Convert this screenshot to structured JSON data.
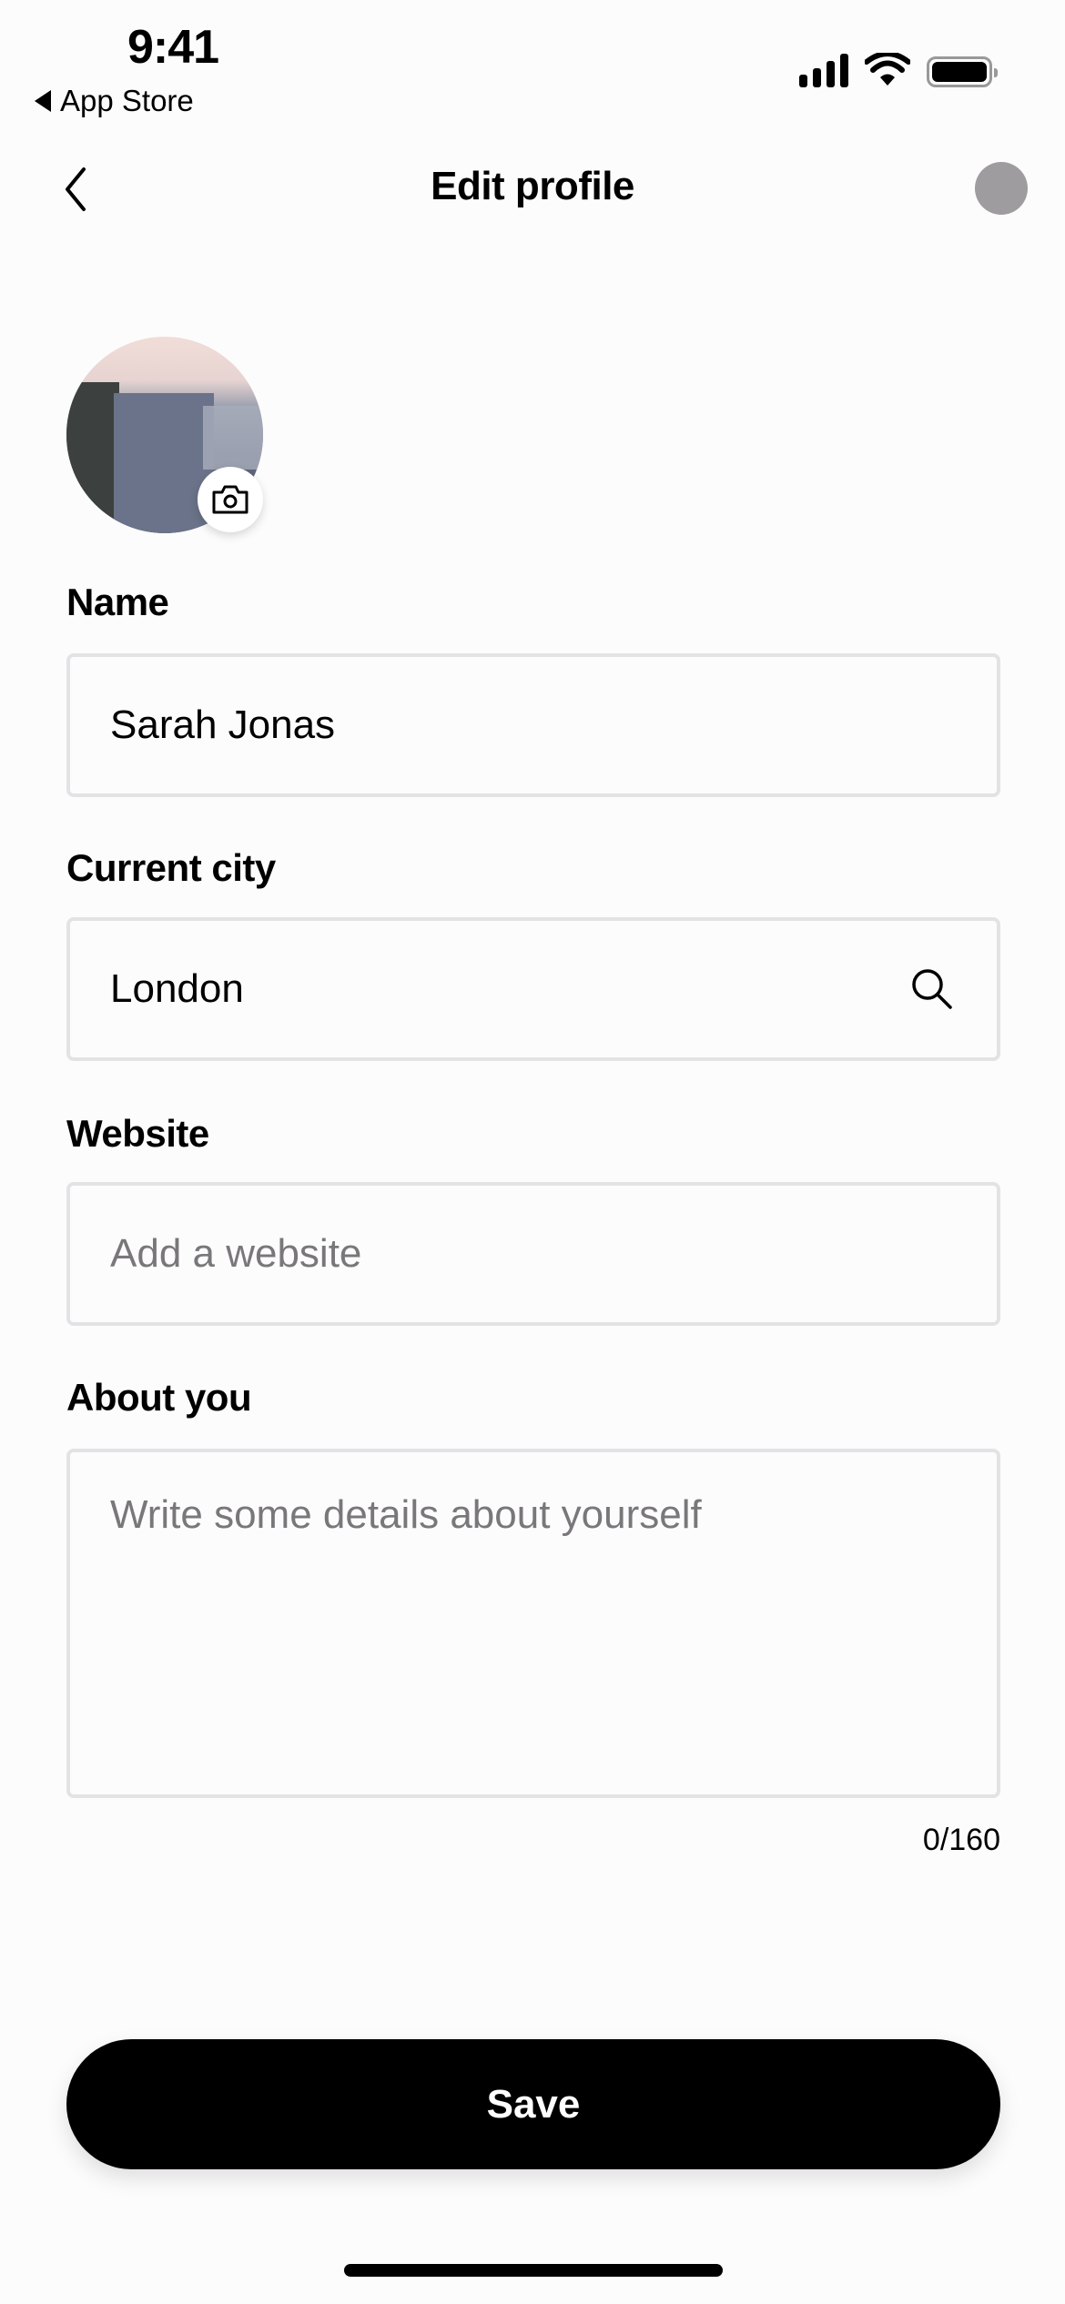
{
  "status_bar": {
    "time": "9:41",
    "back_app_label": "App Store"
  },
  "nav": {
    "title": "Edit profile",
    "back_icon": "chevron-left-icon"
  },
  "avatar": {
    "alt": "Profile photo of sea cliffs",
    "edit_icon": "camera-icon"
  },
  "form": {
    "name": {
      "label": "Name",
      "value": "Sarah Jonas",
      "placeholder": ""
    },
    "city": {
      "label": "Current city",
      "value": "London",
      "placeholder": "",
      "icon": "search-icon"
    },
    "website": {
      "label": "Website",
      "value": "",
      "placeholder": "Add a website"
    },
    "about": {
      "label": "About you",
      "value": "",
      "placeholder": "Write some details about yourself",
      "counter": "0/160"
    }
  },
  "actions": {
    "save_label": "Save"
  },
  "colors": {
    "background": "#fdfcfd",
    "field_border": "#e3e2e4",
    "placeholder": "#79777a",
    "primary_button": "#000000",
    "menu_dot": "#9e9c9f"
  }
}
